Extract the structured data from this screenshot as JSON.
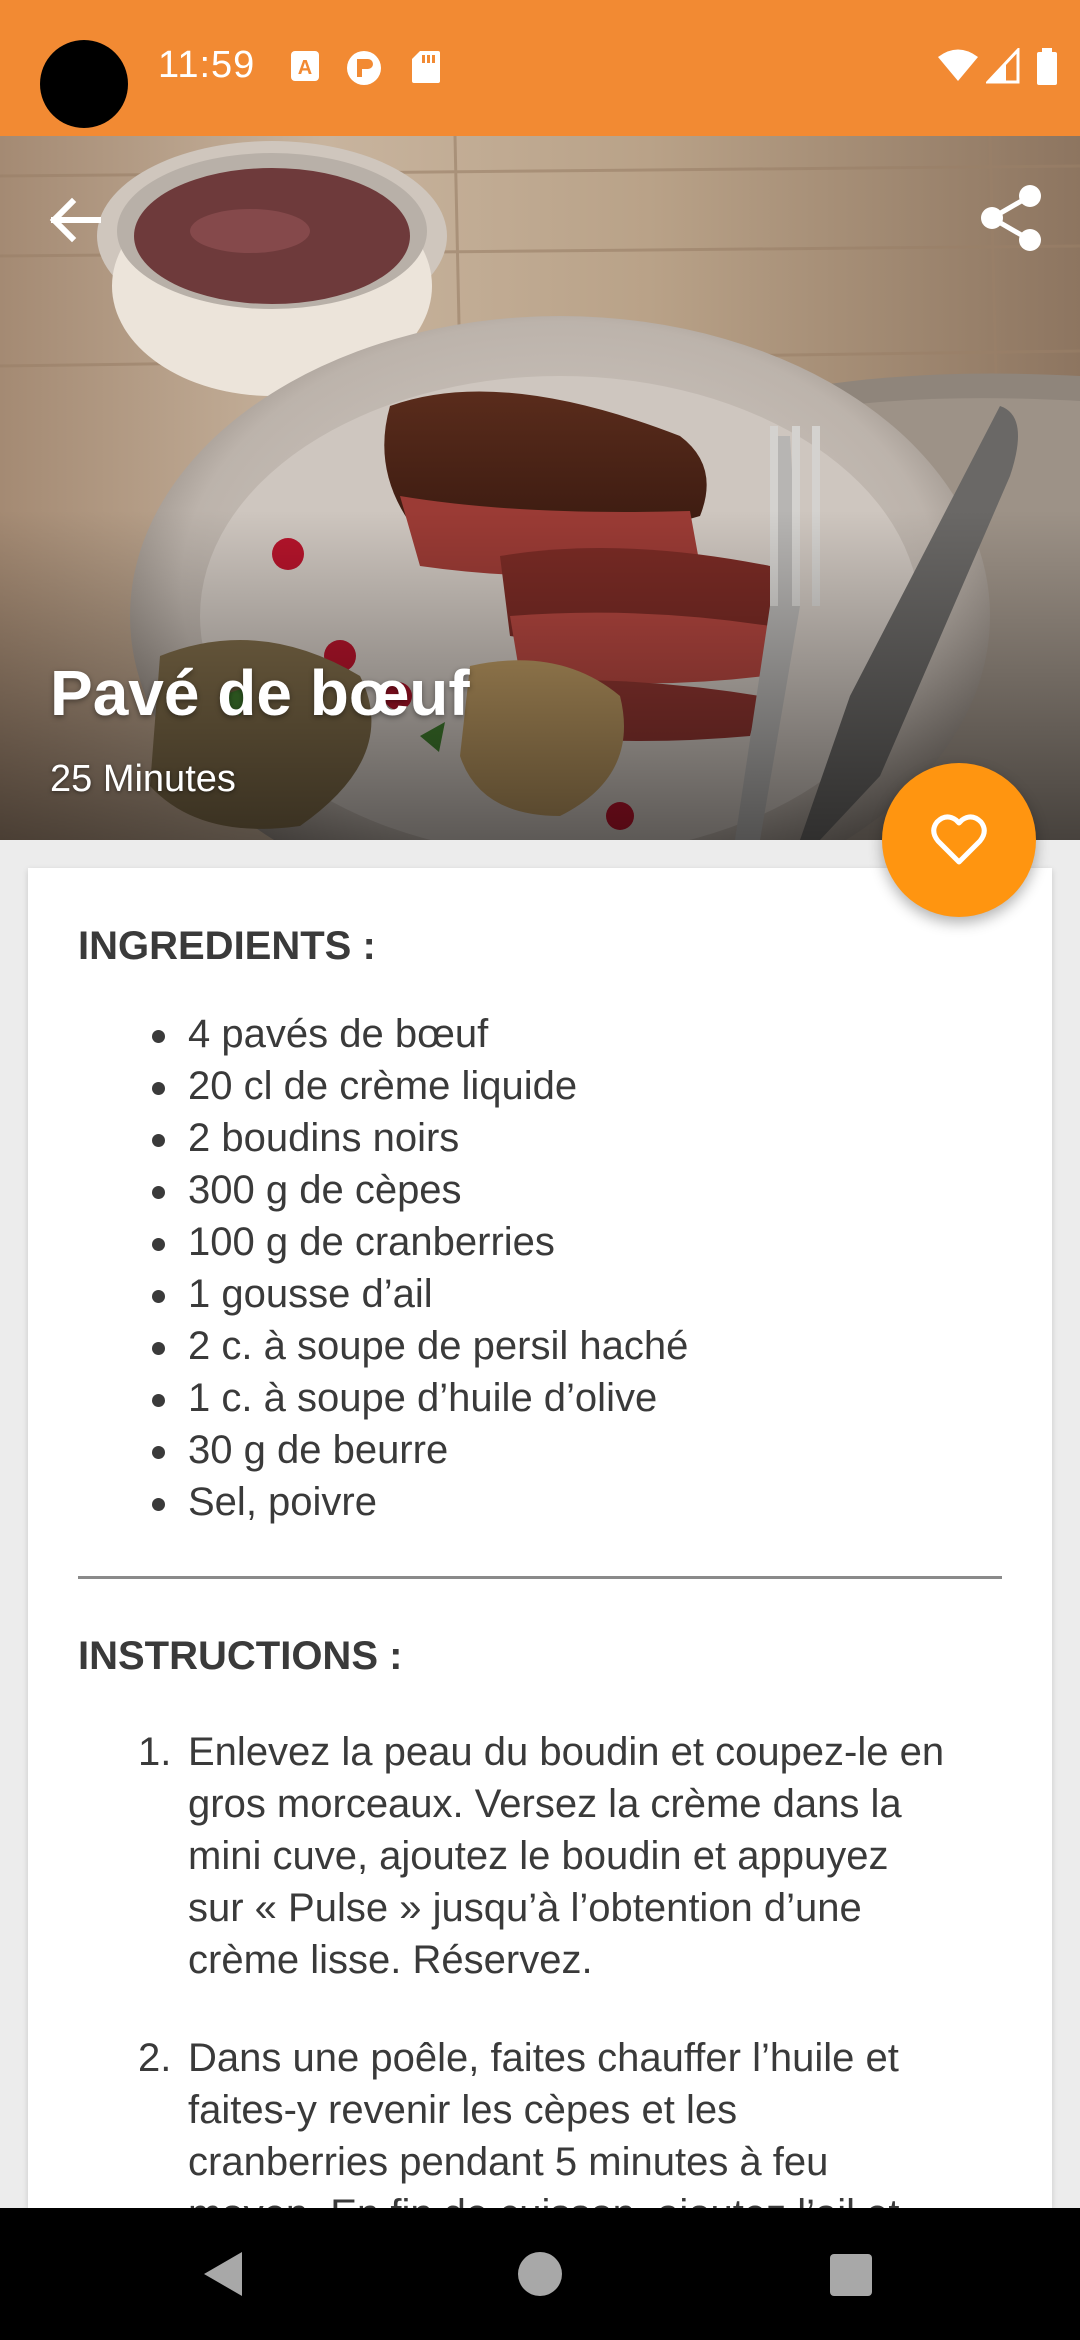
{
  "status_bar": {
    "time": "11:59",
    "icons_left": [
      "a-notification-icon",
      "r-notification-icon",
      "sd-card-icon"
    ],
    "icons_right": [
      "wifi-icon",
      "signal-icon",
      "battery-icon"
    ],
    "background": "#f28a33"
  },
  "hero": {
    "title": "Pavé de bœuf",
    "duration": "25 Minutes",
    "back_icon": "arrow-back-icon",
    "share_icon": "share-icon"
  },
  "fab": {
    "icon": "heart-outline-icon",
    "color": "#ff9510"
  },
  "ingredients": {
    "heading": "INGREDIENTS :",
    "items": [
      "4 pavés de bœuf",
      "20 cl de crème liquide",
      "2 boudins noirs",
      "300 g de cèpes",
      "100 g de cranberries",
      "1 gousse d’ail",
      "2 c. à soupe de persil haché",
      "1 c. à soupe d’huile d’olive",
      "30 g de beurre",
      "Sel, poivre"
    ]
  },
  "instructions": {
    "heading": "INSTRUCTIONS :",
    "steps": [
      {
        "num": "1.",
        "lines": [
          "Enlevez la peau du boudin et coupez-le en",
          "gros morceaux. Versez la crème dans la",
          "mini cuve, ajoutez le boudin et appuyez",
          "sur « Pulse » jusqu’à l’obtention d’une",
          "crème lisse. Réservez."
        ]
      },
      {
        "num": "2.",
        "lines": [
          "Dans une poêle, faites chauffer l’huile et",
          "faites-y revenir les cèpes et les",
          "cranberries pendant 5 minutes à feu",
          "moyen. En fin de cuisson, ajoutez l’ail et"
        ]
      }
    ]
  },
  "nav_bar": {
    "icons": [
      "nav-back-icon",
      "nav-home-icon",
      "nav-recents-icon"
    ]
  }
}
